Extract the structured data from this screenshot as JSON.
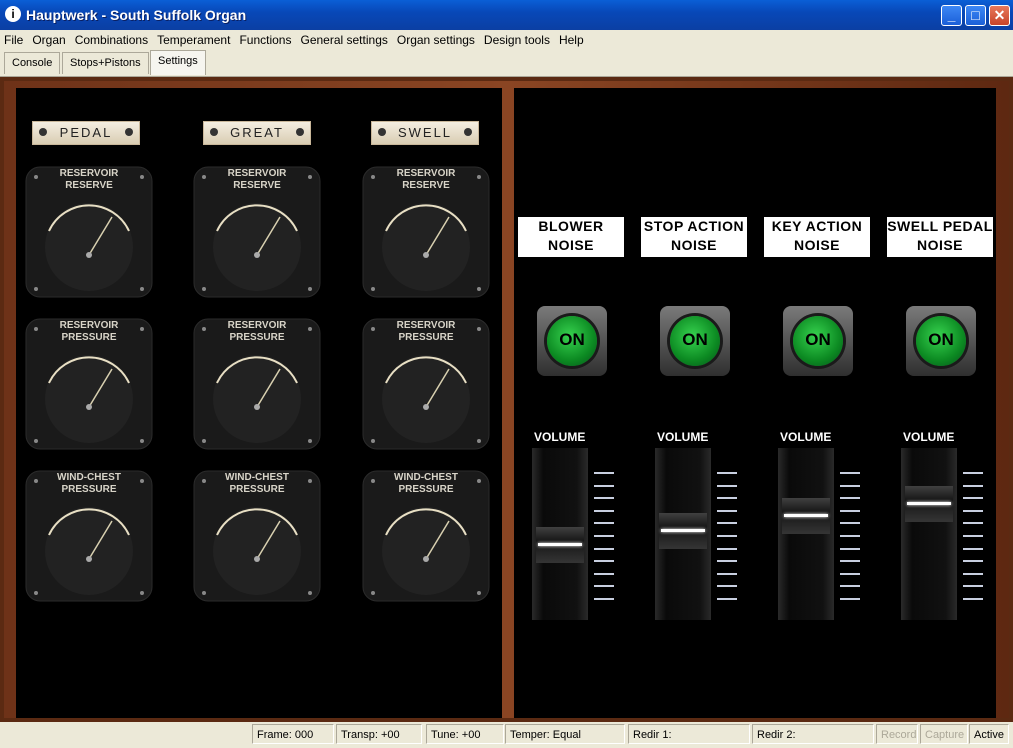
{
  "window": {
    "title": "Hauptwerk - South Suffolk Organ"
  },
  "menu": [
    "File",
    "Organ",
    "Combinations",
    "Temperament",
    "Functions",
    "General settings",
    "Organ settings",
    "Design tools",
    "Help"
  ],
  "tabs": [
    "Console",
    "Stops+Pistons",
    "Settings"
  ],
  "active_tab": "Settings",
  "divisions": [
    "PEDAL",
    "GREAT",
    "SWELL"
  ],
  "gauges": {
    "reserve": {
      "line1": "RESERVOIR",
      "line2": "RESERVE"
    },
    "pressure": {
      "line1": "RESERVOIR",
      "line2": "PRESSURE"
    },
    "windchest": {
      "line1": "WIND-CHEST",
      "line2": "PRESSURE"
    }
  },
  "noise": [
    {
      "line1": "BLOWER",
      "line2": "NOISE",
      "state": "ON",
      "volume_label": "VOLUME",
      "volume_pct": 42
    },
    {
      "line1": "STOP ACTION",
      "line2": "NOISE",
      "state": "ON",
      "volume_label": "VOLUME",
      "volume_pct": 52
    },
    {
      "line1": "KEY ACTION",
      "line2": "NOISE",
      "state": "ON",
      "volume_label": "VOLUME",
      "volume_pct": 63
    },
    {
      "line1": "SWELL PEDAL",
      "line2": "NOISE",
      "state": "ON",
      "volume_label": "VOLUME",
      "volume_pct": 72
    }
  ],
  "status": {
    "frame": "Frame: 000",
    "transp": "Transp: +00",
    "tune": "Tune: +00",
    "temper": "Temper: Equal",
    "redir1": "Redir 1:",
    "redir2": "Redir 2:",
    "record": "Record",
    "capture": "Capture",
    "active": "Active"
  },
  "colors": {
    "titlebar": "#0a5fd6",
    "lamp_green": "#1fa83a",
    "panel_bg": "#000000",
    "wood": "#7a3b1c"
  }
}
